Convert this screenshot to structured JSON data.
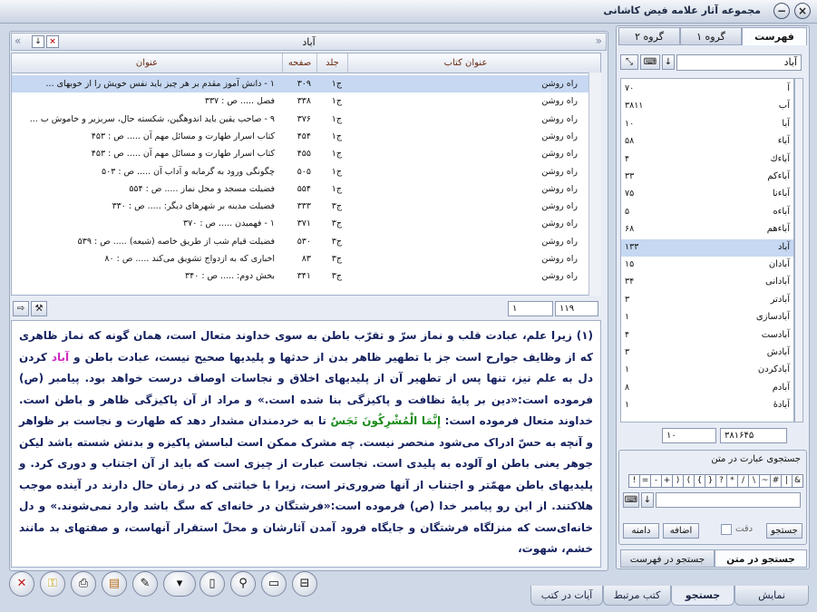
{
  "window": {
    "title": "مجموعه آثار علامه فیض کاشانی",
    "close_glyph": "×",
    "minimize_glyph": "−"
  },
  "search_bar": {
    "term": "آباد"
  },
  "table": {
    "headers": {
      "book": "عنوان کتاب",
      "volume": "جلد",
      "page": "صفحه",
      "title": "عنوان"
    },
    "rows": [
      {
        "book": "راه روشن",
        "volume": "ج۱",
        "page": "۳۰۹",
        "title": "۱ - دانش آموز مقدم بر هر چیز باید نفس خویش را از خوبهای ..."
      },
      {
        "book": "راه روشن",
        "volume": "ج۱",
        "page": "۳۳۸",
        "title": "فصل ..... ص : ۳۳۷"
      },
      {
        "book": "راه روشن",
        "volume": "ج۱",
        "page": "۳۷۶",
        "title": "۹ - صاحب یقین باید اندوهگین، شکسته حال، سربزیر و خاموش ب ..."
      },
      {
        "book": "راه روشن",
        "volume": "ج۱",
        "page": "۴۵۴",
        "title": "کتاب اسرار طهارت و مسائل مهم آن ..... ص : ۴۵۳"
      },
      {
        "book": "راه روشن",
        "volume": "ج۱",
        "page": "۴۵۵",
        "title": "کتاب اسرار طهارت و مسائل مهم آن ..... ص : ۴۵۳"
      },
      {
        "book": "راه روشن",
        "volume": "ج۱",
        "page": "۵۰۵",
        "title": "چگونگی ورود به گرمابه و آداب آن ..... ص : ۵۰۳"
      },
      {
        "book": "راه روشن",
        "volume": "ج۱",
        "page": "۵۵۴",
        "title": "فضیلت مسجد و محل نماز ..... ص : ۵۵۴"
      },
      {
        "book": "راه روشن",
        "volume": "ج۳",
        "page": "۳۳۳",
        "title": "فضیلت مدینه بر شهرهای دیگر: ..... ص : ۳۳۰"
      },
      {
        "book": "راه روشن",
        "volume": "ج۳",
        "page": "۳۷۱",
        "title": "۱ - فهمیدن ..... ص : ۳۷۰"
      },
      {
        "book": "راه روشن",
        "volume": "ج۳",
        "page": "۵۳۰",
        "title": "فضیلت قیام شب از طریق خاصه (شیعه) ..... ص : ۵۳۹"
      },
      {
        "book": "راه روشن",
        "volume": "ج۳",
        "page": "۸۳",
        "title": "اخباری که به ازدواج تشویق می‌کند ..... ص : ۸۰"
      },
      {
        "book": "راه روشن",
        "volume": "ج۳",
        "page": "۳۴۱",
        "title": "بخش دوم: ..... ص : ۳۴۰"
      }
    ]
  },
  "table_nav": {
    "total": "۱۱۹",
    "current": "۱"
  },
  "text": {
    "p1_a": "(۱) زیرا علم، عبادت قلب و نماز سرّ و تقرّب باطن به سوی خداوند متعال است، همان گونه که نماز ظاهری که از وظایف جوارح است جز با تطهیر ظاهر بدن از حدثها و پلیدیها صحیح نیست، عبادت باطن و ",
    "highlight": "آباد",
    "p1_b": " کردن دل به علم نیز، تنها پس از تطهیر آن از پلیدیهای اخلاق و نجاسات اوصاف درست خواهد بود. پیامبر (ص) فرموده است:«دین بر پایهٔ نظافت و پاکیزگی بنا شده است.» و مراد از آن پاکیزگی ظاهر و باطن است. خداوند متعال فرموده است: ",
    "quran": "إِنَّمَا الْمُشْرِكُونَ نَجَسٌ",
    "p1_c": " تا به خردمندان مشدار دهد که طهارت و نجاست بر ظواهر و آنچه به حسّ ادراک می‌شود منحصر نیست. چه مشرک ممکن است لباسش پاکیزه و بدنش شسته باشد لیکن جوهر یعنی باطن او آلوده به پلیدی است. نجاست عبارت از چیزی است که باید از آن اجتناب و دوری کرد. و پلیدیهای باطن مهمّتر و اجتناب از آنها ضروری‌تر است، زیرا با خباثتی که در زمان حال دارند در آینده موجب هلاکتند. از این رو پیامبر خدا (ص) فرموده است:«فرشتگان در خانه‌ای که سگ باشد وارد نمی‌شوند.» و دل خانه‌ای‌ست که منزلگاه فرشتگان و جایگاه فرود آمدن آثارشان و محلّ استقرار آنهاست، و صفتهای بد مانند خشم، شهوت،"
  },
  "bottom_tabs": [
    "نمایش",
    "جستجو",
    "کتب مرتبط",
    "آیات در کتب"
  ],
  "right_panel": {
    "tabs": [
      "فهرست",
      "گروه ۱",
      "گروه ۲"
    ],
    "index_search_value": "آباد",
    "index_items": [
      {
        "word": "آ",
        "count": "۷۰"
      },
      {
        "word": "آب",
        "count": "۳۸۱۱"
      },
      {
        "word": "آبا",
        "count": "۱۰"
      },
      {
        "word": "آباء",
        "count": "۵۸"
      },
      {
        "word": "آباءك",
        "count": "۴"
      },
      {
        "word": "آباءكم",
        "count": "۳۳"
      },
      {
        "word": "آباءنا",
        "count": "۷۵"
      },
      {
        "word": "آباءه",
        "count": "۵"
      },
      {
        "word": "آباءهم",
        "count": "۶۸"
      },
      {
        "word": "آباد",
        "count": "۱۳۳"
      },
      {
        "word": "آبادان",
        "count": "۱۵"
      },
      {
        "word": "آبادانی",
        "count": "۳۴"
      },
      {
        "word": "آبادتر",
        "count": "۳"
      },
      {
        "word": "آبادسازی",
        "count": "۱"
      },
      {
        "word": "آبادست",
        "count": "۴"
      },
      {
        "word": "آبادش",
        "count": "۳"
      },
      {
        "word": "آبادکردن",
        "count": "۱"
      },
      {
        "word": "آبادم",
        "count": "۸"
      },
      {
        "word": "آبادهٔ",
        "count": "۱"
      }
    ],
    "index_nav": {
      "total": "۳۸۱۶۴۵",
      "current": "۱۰"
    },
    "text_search": {
      "header": "جستجوی عبارت در متن",
      "operators": [
        "&",
        "|",
        "#",
        "~",
        "\\",
        "/",
        "*",
        "?",
        "}",
        "{",
        "(",
        ")",
        "+",
        "-",
        "=",
        "!"
      ],
      "search_button": "جستجو",
      "exact_label": "دقت",
      "prefix_button": "اضافه",
      "stem_button": "دامنه"
    },
    "bottom_tabs": [
      "جستجو در متن",
      "جستجو در فهرست"
    ]
  }
}
